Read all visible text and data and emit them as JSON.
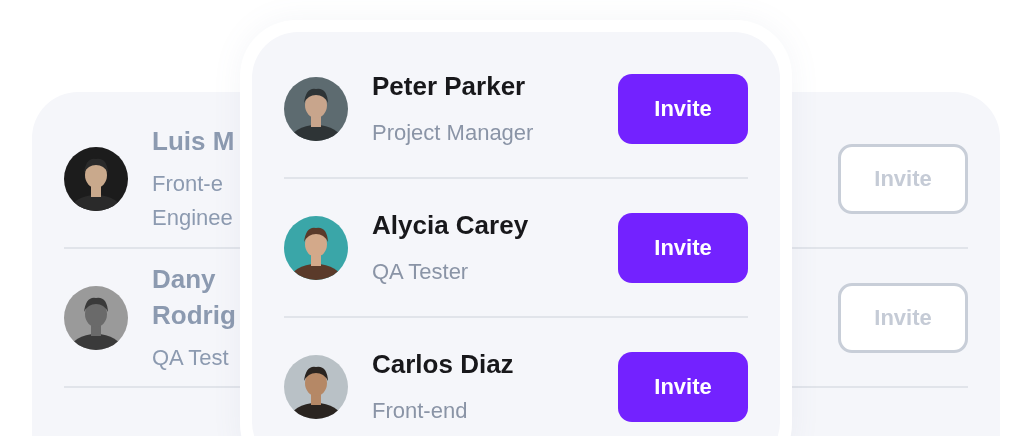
{
  "back_list": {
    "rows": [
      {
        "name": "Luis M",
        "role": "Front-e Enginee",
        "button": {
          "label": "Invite",
          "disabled": true
        }
      },
      {
        "name": "Dany Rodrig",
        "role": "QA Test",
        "button": {
          "label": "Invite",
          "disabled": true
        }
      }
    ]
  },
  "front_list": {
    "rows": [
      {
        "name": "Peter Parker",
        "role": "Project Manager",
        "button": {
          "label": "Invite",
          "disabled": false
        }
      },
      {
        "name": "Alycia Carey",
        "role": "QA Tester",
        "button": {
          "label": "Invite",
          "disabled": false
        }
      },
      {
        "name": "Carlos Diaz",
        "role": "Front-end",
        "button": {
          "label": "Invite",
          "disabled": false
        }
      }
    ]
  }
}
